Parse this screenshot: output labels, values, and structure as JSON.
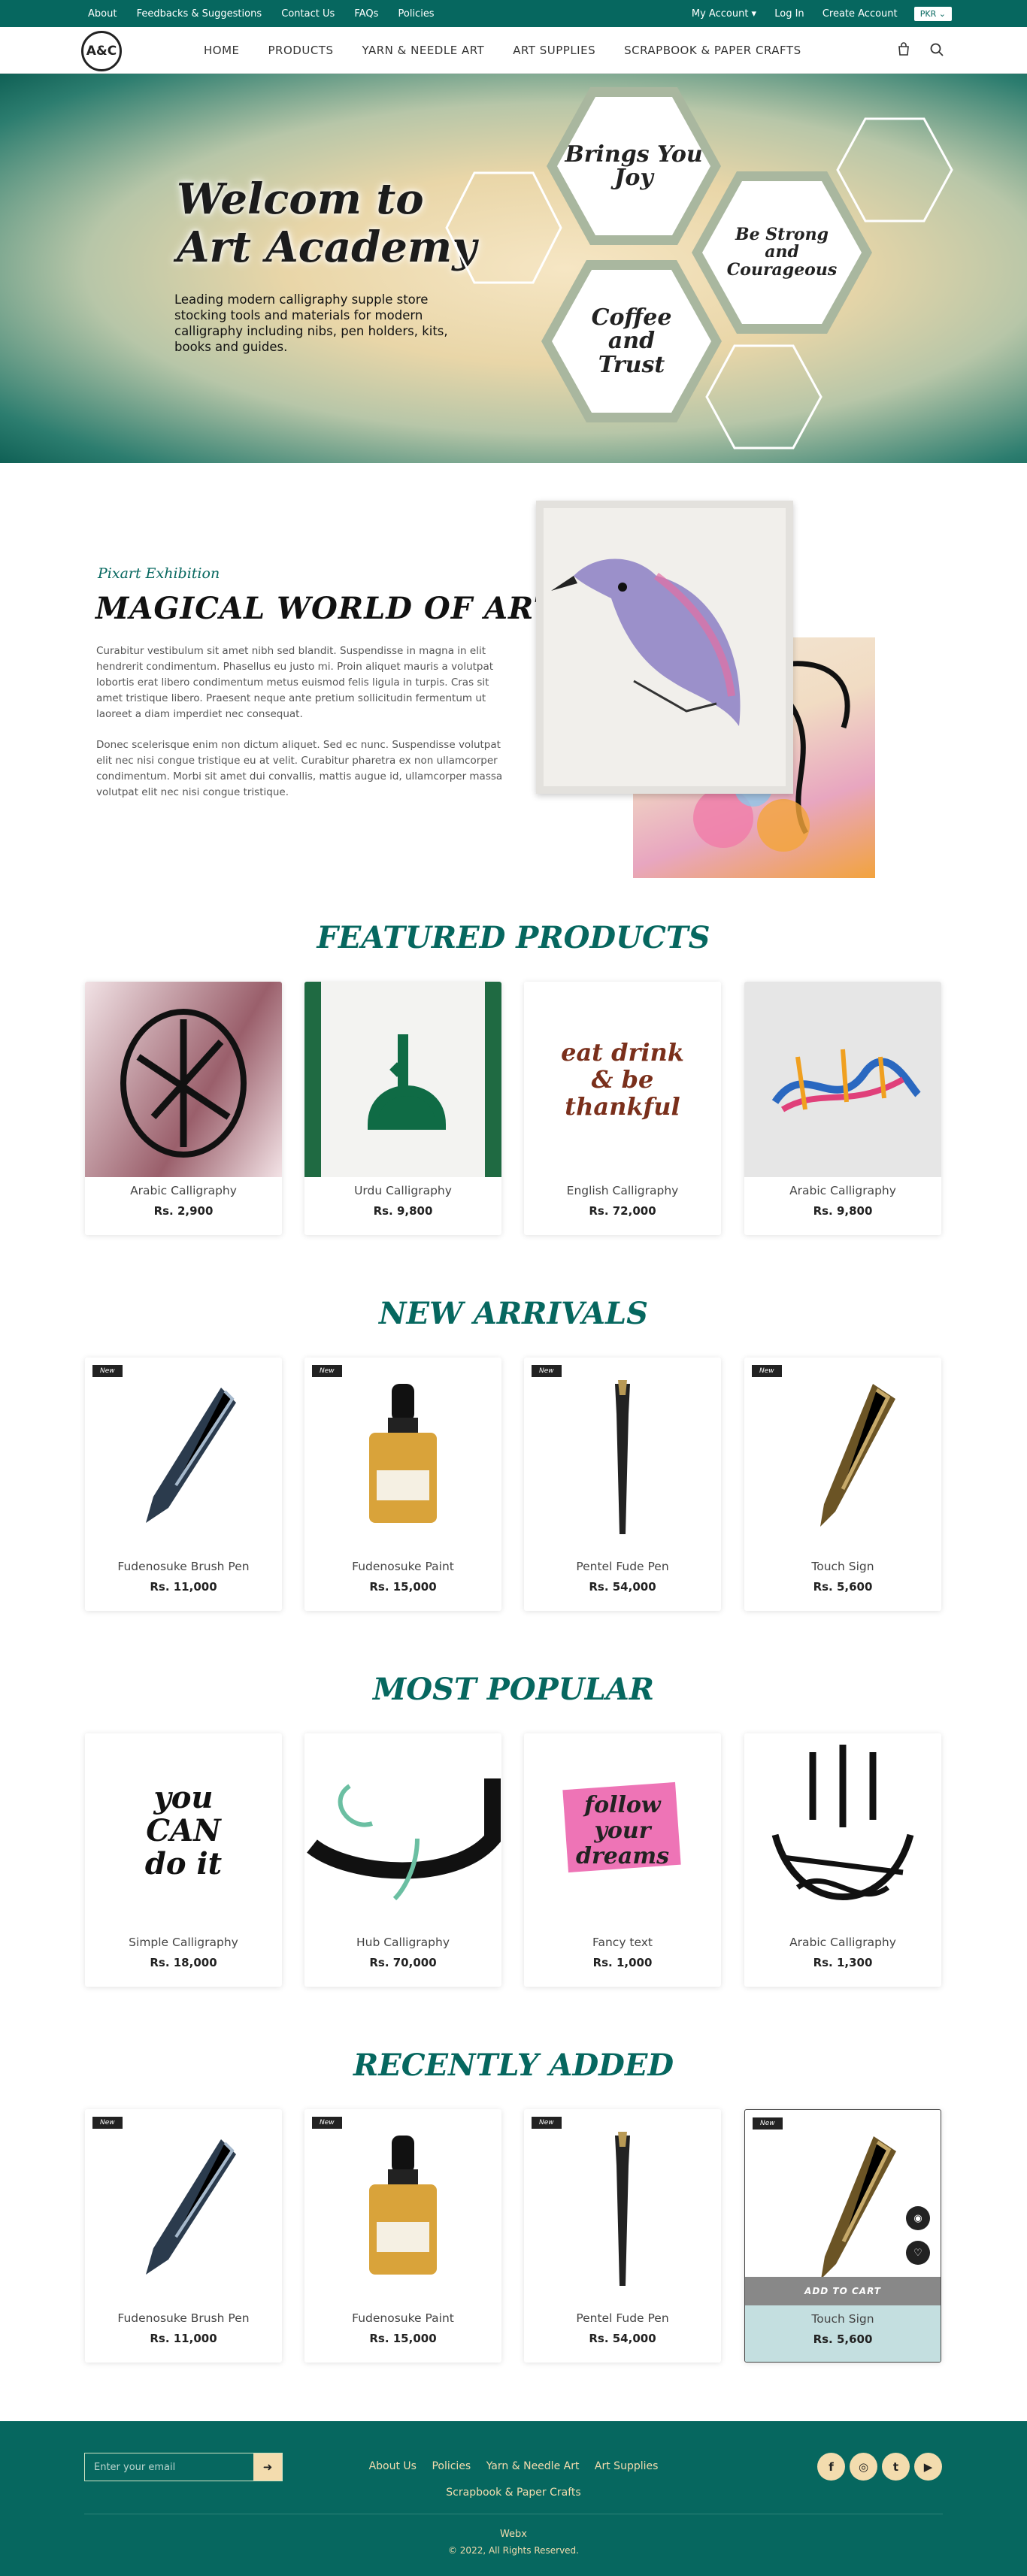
{
  "topbar": {
    "links": [
      "About",
      "Feedbacks & Suggestions",
      "Contact Us",
      "FAQs",
      "Policies"
    ],
    "account": "My Account",
    "login": "Log In",
    "create": "Create Account",
    "currency": "PKR"
  },
  "nav": {
    "logo": "A&C",
    "items": [
      "HOME",
      "PRODUCTS",
      "YARN & NEEDLE ART",
      "ART SUPPLIES",
      "SCRAPBOOK & PAPER CRAFTS"
    ]
  },
  "hero": {
    "title_line1": "Welcom to",
    "title_line2": "Art Academy",
    "text": "Leading modern calligraphy supple store stocking tools and materials for modern calligraphy including nibs, pen holders, kits, books and guides.",
    "hex1": "Brings You Joy",
    "hex2": "Be Strong and Courageous",
    "hex3": "Coffee and Trust"
  },
  "about": {
    "subtitle": "Pixart Exhibition",
    "title": "MAGICAL WORLD OF ART",
    "p1": "Curabitur vestibulum sit amet nibh sed blandit. Suspendisse in magna in elit hendrerit condimentum. Phasellus eu justo mi. Proin aliquet mauris a volutpat lobortis erat libero condimentum metus euismod felis ligula in turpis. Cras sit amet tristique libero. Praesent neque ante pretium sollicitudin fermentum ut laoreet a diam imperdiet nec consequat.",
    "p2": "Donec scelerisque enim non dictum aliquet. Sed ec nunc. Suspendisse volutpat elit nec nisi congue tristique eu at velit. Curabitur pharetra ex non ullamcorper condimentum. Morbi sit amet dui convallis, mattis augue id, ullamcorper massa volutpat elit nec nisi congue tristique."
  },
  "sections": {
    "featured": {
      "title": "FEATURED PRODUCTS",
      "items": [
        {
          "name": "Arabic Calligraphy",
          "price": "Rs. 2,900"
        },
        {
          "name": "Urdu Calligraphy",
          "price": "Rs. 9,800"
        },
        {
          "name": "English Calligraphy",
          "price": "Rs. 72,000"
        },
        {
          "name": "Arabic Calligraphy",
          "price": "Rs. 9,800"
        }
      ]
    },
    "arrivals": {
      "title": "NEW ARRIVALS",
      "badge": "New",
      "items": [
        {
          "name": "Fudenosuke Brush Pen",
          "price": "Rs. 11,000"
        },
        {
          "name": "Fudenosuke Paint",
          "price": "Rs. 15,000"
        },
        {
          "name": "Pentel Fude Pen",
          "price": "Rs. 54,000"
        },
        {
          "name": "Touch Sign",
          "price": "Rs. 5,600"
        }
      ]
    },
    "popular": {
      "title": "MOST POPULAR",
      "items": [
        {
          "name": "Simple Calligraphy",
          "price": "Rs. 18,000"
        },
        {
          "name": "Hub Calligraphy",
          "price": "Rs. 70,000"
        },
        {
          "name": "Fancy text",
          "price": "Rs. 1,000"
        },
        {
          "name": "Arabic Calligraphy",
          "price": "Rs. 1,300"
        }
      ]
    },
    "recent": {
      "title": "RECENTLY ADDED",
      "badge": "New",
      "add_to_cart": "ADD TO CART",
      "items": [
        {
          "name": "Fudenosuke Brush Pen",
          "price": "Rs. 11,000"
        },
        {
          "name": "Fudenosuke Paint",
          "price": "Rs. 15,000"
        },
        {
          "name": "Pentel Fude Pen",
          "price": "Rs. 54,000"
        },
        {
          "name": "Touch Sign",
          "price": "Rs. 5,600"
        }
      ]
    }
  },
  "art": {
    "you_can": "you CAN do it",
    "follow": "follow your dreams",
    "eat": "eat drink & be thankful"
  },
  "footer": {
    "email_placeholder": "Enter your email",
    "links": [
      "About Us",
      "Policies",
      "Yarn & Needle Art",
      "Art Supplies"
    ],
    "link2": "Scrapbook & Paper Crafts",
    "brand": "Webx",
    "copyright": "© 2022, All Rights Reserved."
  },
  "colors": {
    "primary": "#06675f",
    "accent": "#f3dcae"
  }
}
